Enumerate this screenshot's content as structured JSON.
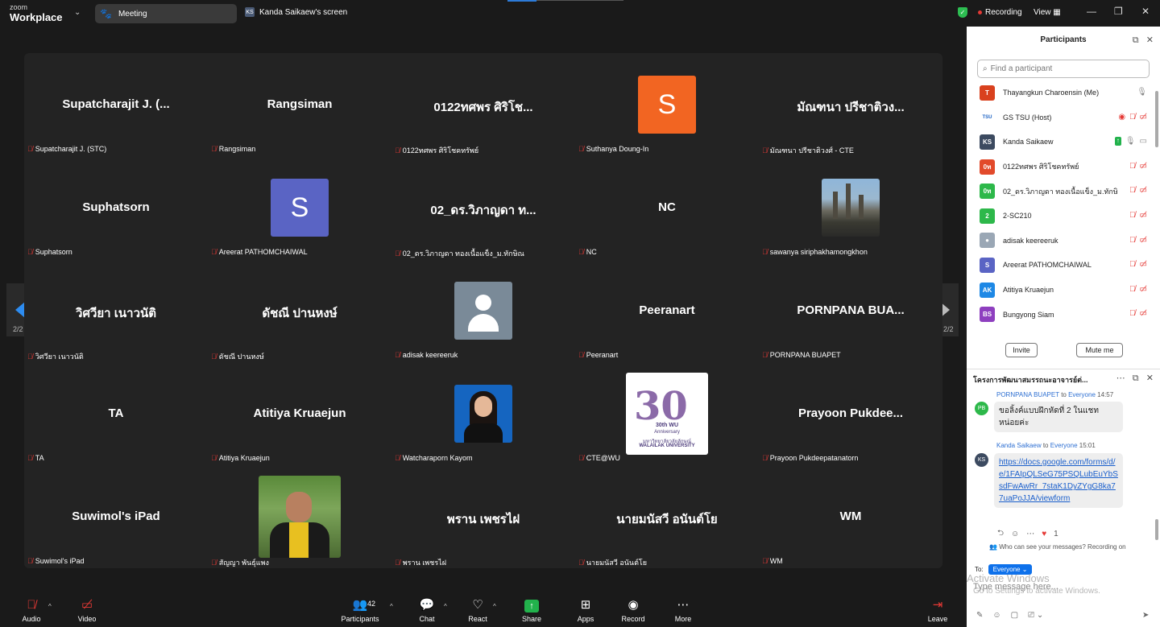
{
  "topbar": {
    "brand_small": "zoom",
    "brand_main": "Workplace",
    "meeting_tab": "Meeting",
    "screen_tab_initials": "KS",
    "screen_tab": "Kanda Saikaew's screen",
    "recording": "Recording",
    "view": "View"
  },
  "gallery": {
    "page_indicator_left": "2/2",
    "page_indicator_right": "2/2",
    "tiles": [
      {
        "big": "Supatcharajit J. (...",
        "label": "Supatcharajit J. (STC)"
      },
      {
        "big": "Rangsiman",
        "label": "Rangsiman"
      },
      {
        "big": "0122ทศพร  ศิริโช...",
        "label": "0122ทศพร  ศิริโชคทรัพย์"
      },
      {
        "avatar_letter": "S",
        "avatar_color": "#f26522",
        "label": "Suthanya Doung-In"
      },
      {
        "big": "มัณฑนา ปรีชาติวง...",
        "label": "มัณฑนา ปรีชาติวงศ์ - CTE"
      },
      {
        "big": "Suphatsorn",
        "label": "Suphatsorn"
      },
      {
        "avatar_letter": "S",
        "avatar_color": "#5a64c4",
        "label": "Areerat  PATHOMCHAIWAL"
      },
      {
        "big": "02_ดร.วิภาญดา ท...",
        "label": "02_ดร.วิภาญดา ทองเนื้อแข็ง_ม.ทักษิณ"
      },
      {
        "big": "NC",
        "label": "NC"
      },
      {
        "label": "sawanya siriphakhamongkhon"
      },
      {
        "big": "วิศวียา เนาวนัติ",
        "label": "วิศวียา เนาวนัติ"
      },
      {
        "big": "ดัชณี ปานหงษ์",
        "label": "ดัชณี ปานหงษ์"
      },
      {
        "label": "adisak keereeruk"
      },
      {
        "big": "Peeranart",
        "label": "Peeranart"
      },
      {
        "big": "PORNPANA  BUA...",
        "label": "PORNPANA BUAPET"
      },
      {
        "big": "TA",
        "label": "TA"
      },
      {
        "big": "Atitiya Kruaejun",
        "label": "Atitiya Kruaejun"
      },
      {
        "label": "Watcharaporn Kayom"
      },
      {
        "label": "CTE@WU"
      },
      {
        "big": "Prayoon  Pukdee...",
        "label": "Prayoon Pukdeepatanatorn"
      },
      {
        "big": "Suwimol's iPad",
        "label": "Suwimol's iPad"
      },
      {
        "label": "สัญญา พันธุ์แพง"
      },
      {
        "big": "พราน เพชรไฝ",
        "label": "พราน เพชรไฝ"
      },
      {
        "big": "นายมนัสวี อนันต์โย",
        "label": "นายมนัสวี อนันต์โย"
      },
      {
        "big": "WM",
        "label": "WM"
      }
    ],
    "logo_text_1": "30th WU",
    "logo_text_2": "Anniversary",
    "logo_text_3": "มหาวิทยาลัยวลัยลักษณ์",
    "logo_text_4": "WALAILAK UNIVERSITY"
  },
  "toolbar": {
    "audio": "Audio",
    "video": "Video",
    "participants": "Participants",
    "participants_count": "42",
    "chat": "Chat",
    "react": "React",
    "share": "Share",
    "apps": "Apps",
    "record": "Record",
    "more": "More",
    "leave": "Leave"
  },
  "participants_panel": {
    "title": "Participants",
    "search_placeholder": "Find a participant",
    "invite": "Invite",
    "mute_me": "Mute me",
    "rows": [
      {
        "initials": "T",
        "color": "#d9411e",
        "name": "Thayangkun Charoensin (Me)"
      },
      {
        "initials": "TSU",
        "color": "#ffffff",
        "name": "GS TSU (Host)"
      },
      {
        "initials": "KS",
        "color": "#3c4a60",
        "name": "Kanda Saikaew"
      },
      {
        "initials": "0ท",
        "color": "#e24a2b",
        "name": "0122ทศพร  ศิริโชคทรัพย์"
      },
      {
        "initials": "0ท",
        "color": "#2db84a",
        "name": "02_ดร.วิภาญดา ทองเนื้อแข็ง_ม.ทักษิณ"
      },
      {
        "initials": "2",
        "color": "#2db84a",
        "name": "2-SC210"
      },
      {
        "initials": "",
        "color": "#9aa7b5",
        "name": "adisak keereeruk"
      },
      {
        "initials": "S",
        "color": "#5a64c4",
        "name": "Areerat  PATHOMCHAIWAL"
      },
      {
        "initials": "AK",
        "color": "#1e88e5",
        "name": "Atitiya Kruaejun"
      },
      {
        "initials": "BS",
        "color": "#8e3fbf",
        "name": "Bungyong Siam"
      }
    ]
  },
  "chat_panel": {
    "title": "โครงการพัฒนาสมรรถนะอาจารย์ต่...",
    "msg1_from": "PORNPANA BUAPET",
    "msg1_to_word": "to",
    "msg1_to": "Everyone",
    "msg1_time": "14:57",
    "msg1_initials": "PB",
    "msg1_text": "ขอลิ้งค์แบบฝึกหัดที่ 2 ในแชทหน่อยค่ะ",
    "msg2_from": "Kanda Saikaew",
    "msg2_to_word": "to",
    "msg2_to": "Everyone",
    "msg2_time": "15:01",
    "msg2_initials": "KS",
    "msg2_link": "https://docs.google.com/forms/d/e/1FAIpQLSeG75PSQLubEuYbSsdFwAwRr_7staK1DyZYgG8ka77uaPoJJA/viewform",
    "reaction_count": "1",
    "who_can_see": "Who can see your messages? Recording on",
    "to_label": "To:",
    "to_value": "Everyone",
    "input_placeholder": "Type message here...",
    "watermark_1": "Activate Windows",
    "watermark_2": "Go to Settings to activate Windows."
  }
}
